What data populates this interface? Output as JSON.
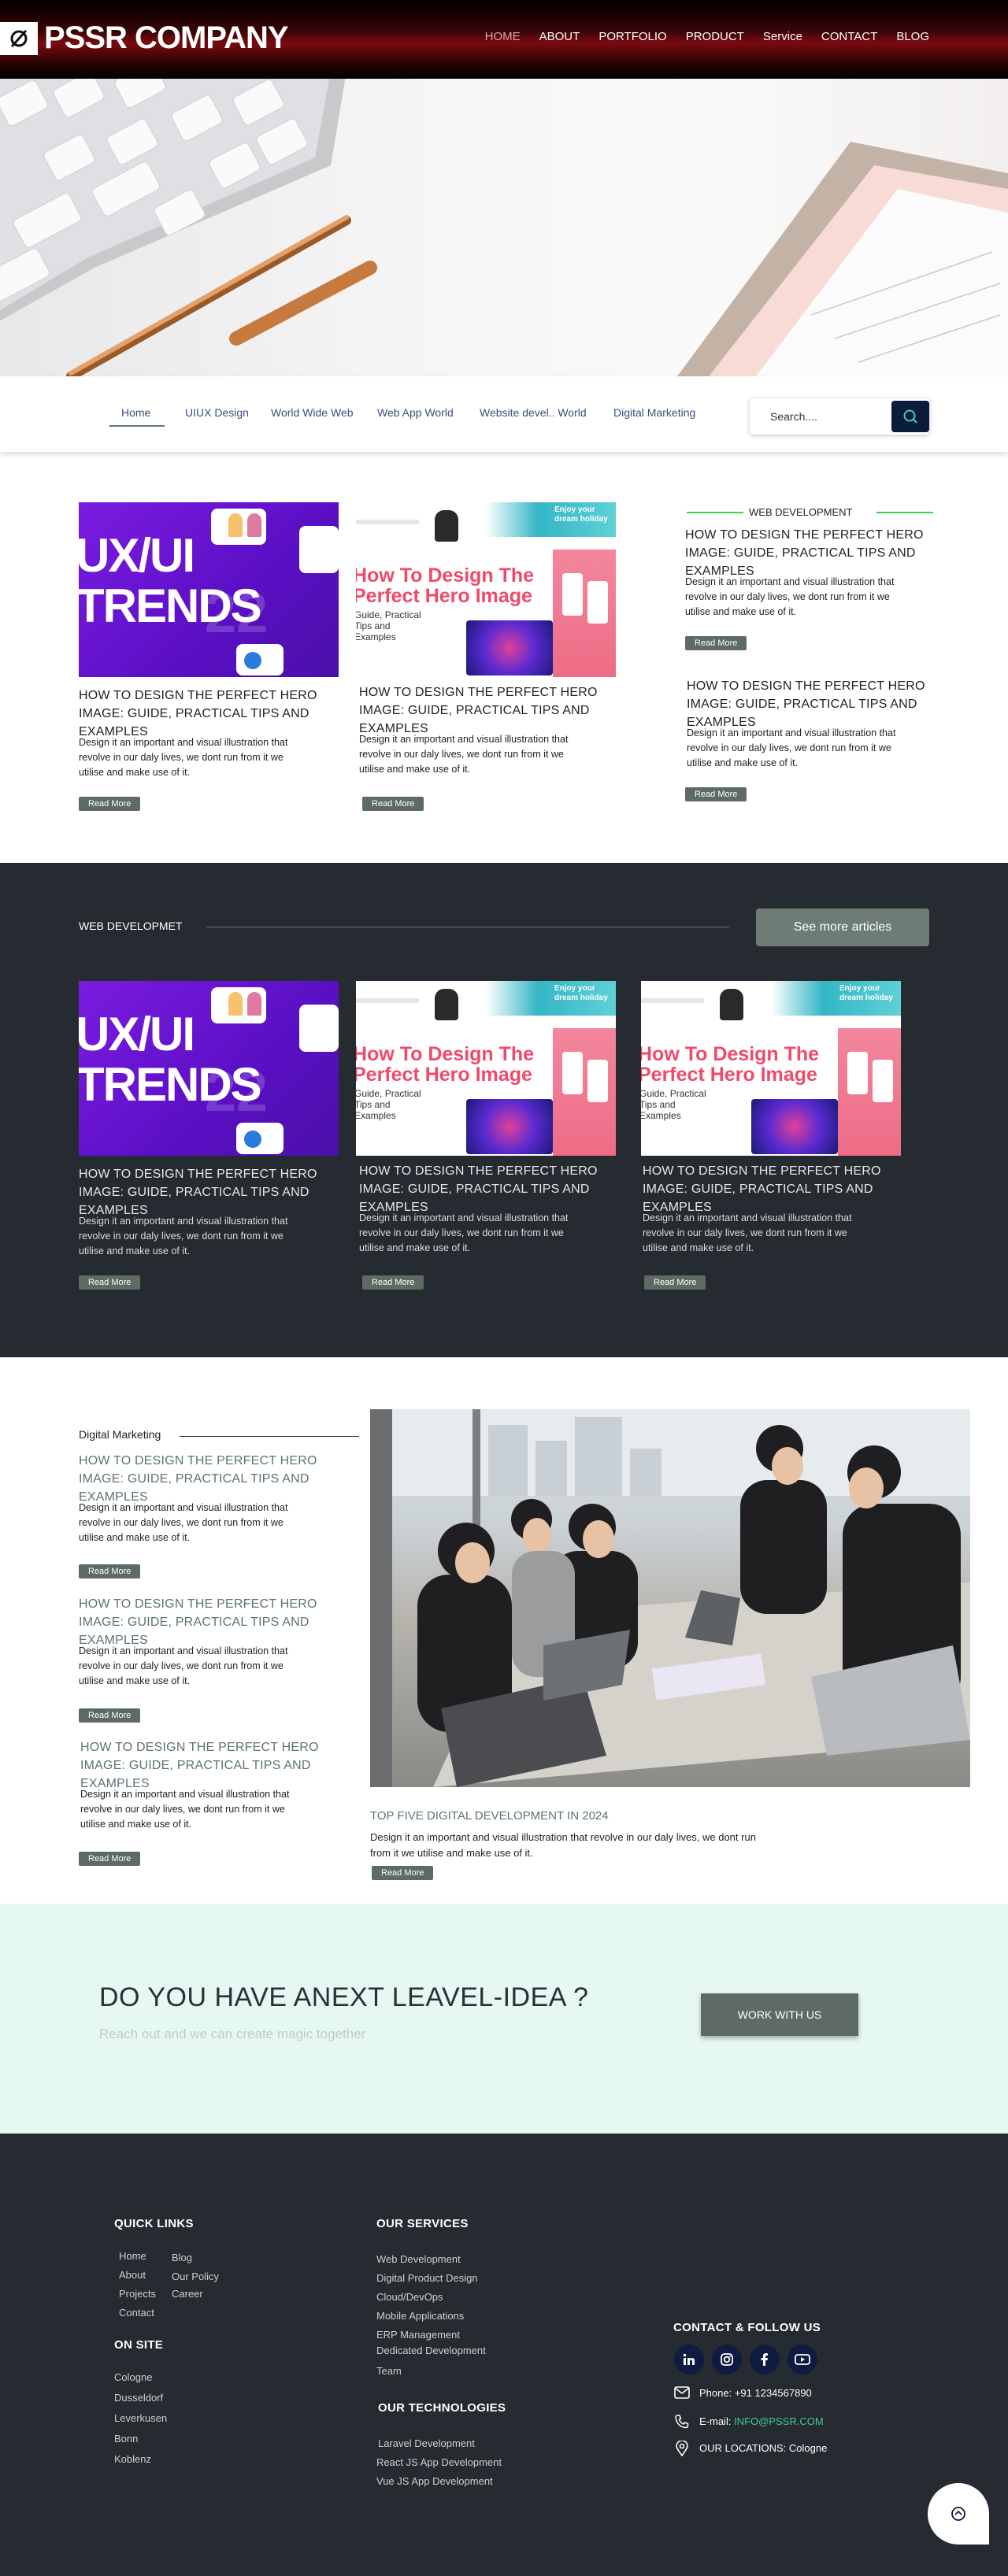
{
  "brand": {
    "name": "PSSR COMPANY"
  },
  "nav": [
    {
      "label": "HOME",
      "active": true
    },
    {
      "label": "ABOUT"
    },
    {
      "label": "PORTFOLIO"
    },
    {
      "label": "PRODUCT"
    },
    {
      "label": "Service"
    },
    {
      "label": "CONTACT"
    },
    {
      "label": "BLOG"
    }
  ],
  "categories": [
    "Home",
    "UIUX Design",
    "World Wide Web",
    "Web App World",
    "Website devel.. World",
    "Digital Marketing"
  ],
  "search": {
    "placeholder": "Search....",
    "icon": "search-icon"
  },
  "featured": {
    "cards": [
      {
        "thumb_text": "UX/UI TRENDS",
        "thumb_ghost": "22",
        "title": "HOW TO DESIGN THE PERFECT HERO IMAGE: GUIDE, PRACTICAL TIPS AND EXAMPLES",
        "desc": "Design it an important and visual illustration that revolve in our daly lives, we dont run from it we utilise and make use of it.",
        "read_more": "Read More"
      },
      {
        "thumb_title": "How To Design The Perfect Hero Image",
        "thumb_sub": "Guide, Practical Tips and Examples",
        "thumb_enjoy": "Enjoy your dream holiday",
        "title": "HOW TO DESIGN THE PERFECT HERO IMAGE: GUIDE, PRACTICAL TIPS AND EXAMPLES",
        "desc": "Design it an important and visual illustration that revolve in our daly lives, we dont run from it we utilise and make use of it.",
        "read_more": "Read More"
      }
    ],
    "side_label": "WEB DEVELOPMENT",
    "side_items": [
      {
        "title": "HOW TO DESIGN THE PERFECT HERO IMAGE: GUIDE, PRACTICAL TIPS AND EXAMPLES",
        "desc": "Design it an important and visual illustration that revolve in our daly lives, we dont run from it we utilise and make use of it.",
        "read_more": "Read More"
      },
      {
        "title": "HOW TO DESIGN THE PERFECT HERO IMAGE: GUIDE, PRACTICAL TIPS AND EXAMPLES",
        "desc": "Design it an important and visual illustration that revolve in our daly lives, we dont run from it we utilise and make use of it.",
        "read_more": "Read More"
      }
    ]
  },
  "webdev": {
    "label": "WEB DEVELOPMET",
    "see_more": "See more articles",
    "cards": [
      {
        "thumb_text": "UX/UI TRENDS",
        "thumb_ghost": "22",
        "title": "HOW TO DESIGN THE PERFECT HERO IMAGE: GUIDE, PRACTICAL TIPS AND EXAMPLES",
        "desc": "Design it an important and visual illustration that revolve in our daly lives, we dont run from it we utilise and make use of it.",
        "read_more": "Read More"
      },
      {
        "thumb_title": "How To Design The Perfect Hero Image",
        "thumb_sub": "Guide, Practical Tips and Examples",
        "thumb_enjoy": "Enjoy your dream holiday",
        "title": "HOW TO DESIGN THE PERFECT HERO IMAGE: GUIDE, PRACTICAL TIPS AND EXAMPLES",
        "desc": "Design it an important and visual illustration that revolve in our daly lives, we dont run from it we utilise and make use of it.",
        "read_more": "Read More"
      },
      {
        "thumb_title": "How To Design The Perfect Hero Image",
        "thumb_sub": "Guide, Practical Tips and Examples",
        "thumb_enjoy": "Enjoy your dream holiday",
        "title": "HOW TO DESIGN THE PERFECT HERO IMAGE: GUIDE, PRACTICAL TIPS AND EXAMPLES",
        "desc": "Design it an important and visual illustration that revolve in our daly lives, we dont run from it we utilise and make use of it.",
        "read_more": "Read More"
      }
    ]
  },
  "digital": {
    "label": "Digital Marketing",
    "items": [
      {
        "title": "HOW TO DESIGN THE PERFECT HERO IMAGE: GUIDE, PRACTICAL TIPS AND EXAMPLES",
        "desc": "Design it an important and visual illustration that revolve in our daly lives, we dont run from it we utilise and make use of it.",
        "read_more": "Read More"
      },
      {
        "title": "HOW TO DESIGN THE PERFECT HERO IMAGE: GUIDE, PRACTICAL TIPS AND EXAMPLES",
        "desc": "Design it an important and visual illustration that revolve in our daly lives, we dont run from it we utilise and make use of it.",
        "read_more": "Read More"
      },
      {
        "title": "HOW TO DESIGN THE PERFECT HERO IMAGE: GUIDE, PRACTICAL TIPS AND EXAMPLES",
        "desc": "Design it an important and visual illustration that revolve in our daly lives, we dont run from it we utilise and make use of it.",
        "read_more": "Read More"
      }
    ],
    "feature_title": "TOP FIVE DIGITAL DEVELOPMENT IN 2024",
    "feature_desc_1": "Design it an important and visual illustration that revolve in our daly lives, we dont run",
    "feature_desc_2": "from it we utilise and make use of it.",
    "feature_read_more": "Read More"
  },
  "cta": {
    "title": "DO YOU HAVE ANEXT LEAVEL-IDEA ?",
    "subtitle": "Reach out and we can create magic together",
    "button": "WORK WITH US"
  },
  "footer": {
    "quick_links_title": "QUICK LINKS",
    "quick_links_col1": [
      "Home",
      "About",
      "Projects",
      "Contact"
    ],
    "quick_links_col2": [
      "Blog",
      "Our Policy",
      "Career"
    ],
    "on_site_title": "ON SITE",
    "on_site": [
      "Cologne",
      "Dusseldorf",
      "Leverkusen",
      "Bonn",
      "Koblenz"
    ],
    "services_title": "OUR SERVICES",
    "services": [
      "Web Development",
      "Digital Product Design",
      "Cloud/DevOps",
      "Mobile Applications",
      "ERP Management",
      "Dedicated Development",
      "Team"
    ],
    "tech_title": "OUR TECHNOLOGIES",
    "technologies": [
      "Laravel Development",
      "React JS App Development",
      "Vue JS App Development"
    ],
    "contact_title": "CONTACT & FOLLOW US",
    "social_icons": [
      "linkedin-icon",
      "instagram-icon",
      "facebook-icon",
      "youtube-icon"
    ],
    "phone_label": "Phone: +91 1234567890",
    "email_prefix": "E-mail: ",
    "email": "INFO@PSSR.COM",
    "locations": "OUR LOCATIONS: Cologne"
  },
  "colors": {
    "accent": "#5d6b64",
    "dark_bg": "#262a31",
    "cta_bg": "#e6f8f2",
    "search_btn": "#0b1b3a",
    "link_accent": "#3ecf8e",
    "side_line": "#3bd14a"
  }
}
